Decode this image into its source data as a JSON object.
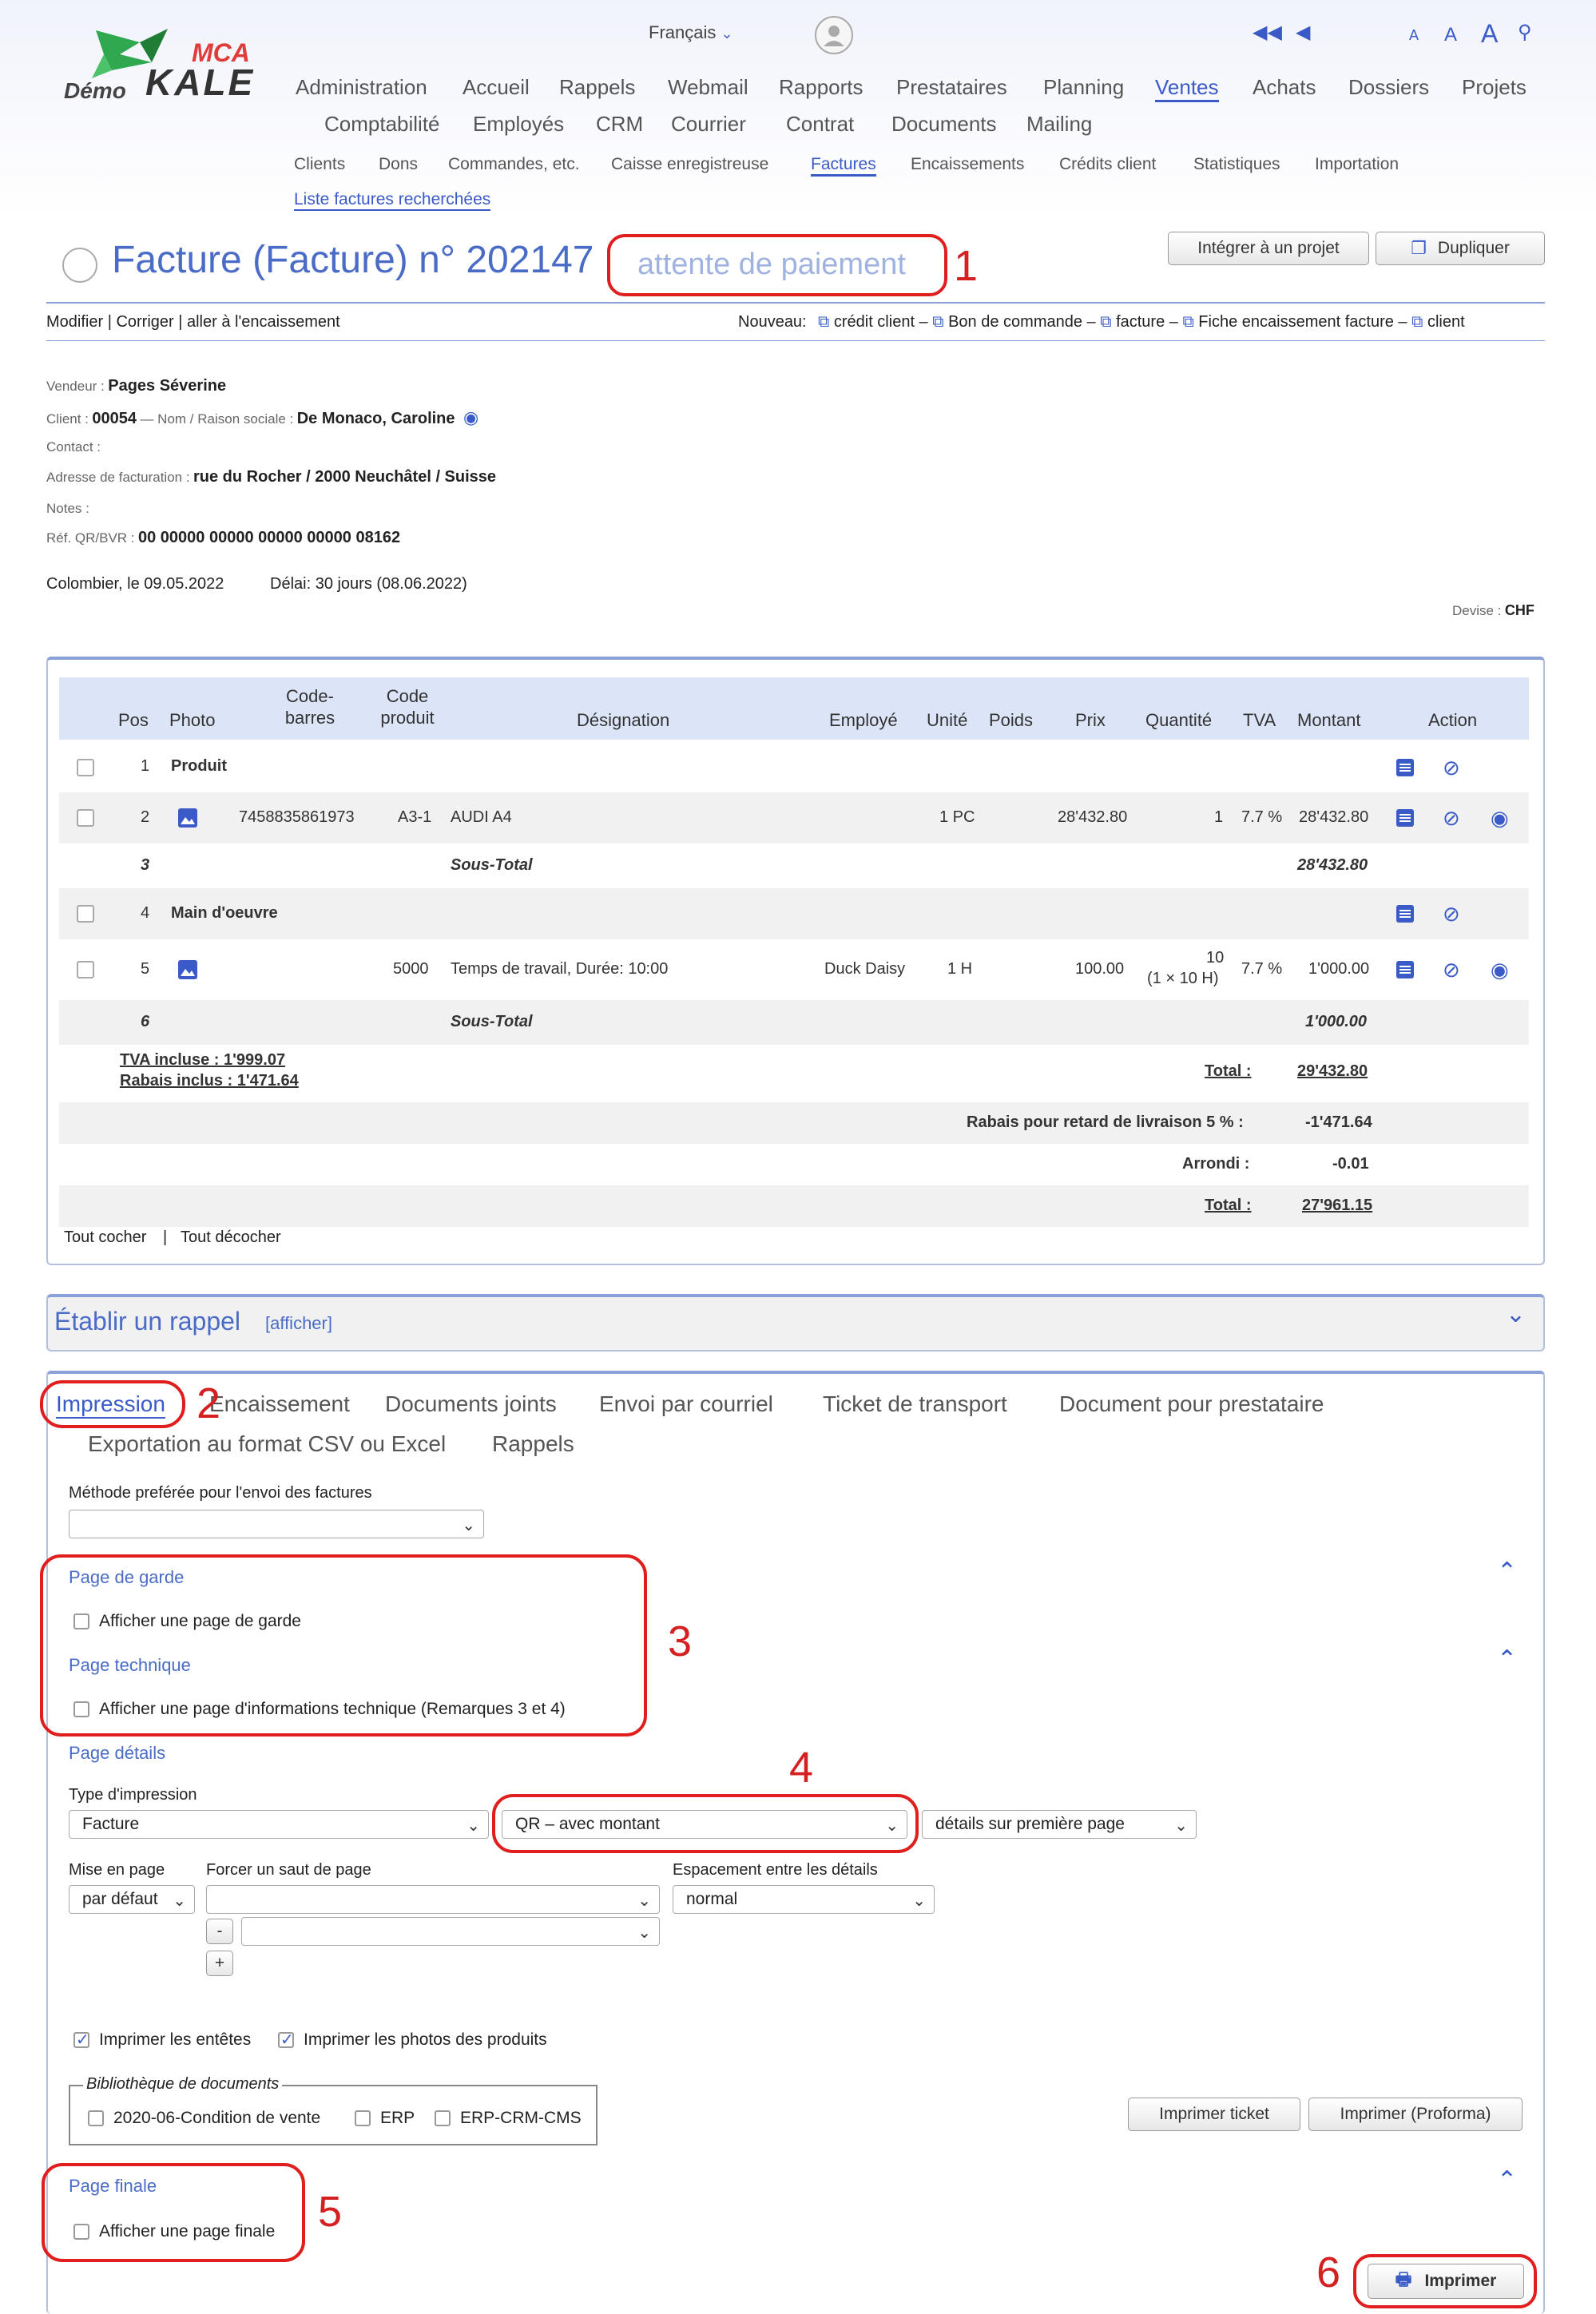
{
  "header": {
    "language": "Français",
    "logo": {
      "top": "MCA",
      "bottom": "KALE",
      "prefix": "Démo"
    },
    "nav_row1": [
      "Administration",
      "Accueil",
      "Rappels",
      "Webmail",
      "Rapports",
      "Prestataires",
      "Planning",
      "Ventes",
      "Achats",
      "Dossiers",
      "Projets"
    ],
    "nav_row2": [
      "Comptabilité",
      "Employés",
      "CRM",
      "Courrier",
      "Contrat",
      "Documents",
      "Mailing"
    ],
    "sub_row1": [
      "Clients",
      "Dons",
      "Commandes, etc.",
      "Caisse enregistreuse",
      "Factures",
      "Encaissements",
      "Crédits client",
      "Statistiques",
      "Importation"
    ],
    "sub_row2": "Liste factures recherchées",
    "text_size": [
      "A",
      "A",
      "A"
    ]
  },
  "invoice": {
    "title": "Facture (Facture) n° 202147",
    "status": "attente de paiement",
    "btn_integrate": "Intégrer à un projet",
    "btn_duplicate": "Dupliquer",
    "actions_left": "Modifier | Corriger | aller à l'encaissement",
    "new_label": "Nouveau:",
    "new_links": [
      "crédit client –",
      "Bon de commande –",
      "facture –",
      "Fiche encaissement facture –",
      "client"
    ],
    "seller_label": "Vendeur :",
    "seller": "Pages Séverine",
    "client_label": "Client :",
    "client_id": "00054",
    "client_sep": "— Nom / Raison sociale :",
    "client_name": "De Monaco, Caroline",
    "contact_label": "Contact :",
    "address_label": "Adresse de facturation :",
    "address": "rue du Rocher / 2000 Neuchâtel / Suisse",
    "notes_label": "Notes :",
    "ref_label": "Réf. QR/BVR :",
    "ref": "00 00000 00000 00000 00000 08162",
    "place_date": "Colombier, le 09.05.2022",
    "delay": "Délai: 30 jours (08.06.2022)",
    "currency_label": "Devise :",
    "currency": "CHF"
  },
  "table": {
    "headers": [
      "Pos",
      "Photo",
      "Code-\nbarres",
      "Code\nproduit",
      "Désignation",
      "Employé",
      "Unité",
      "Poids",
      "Prix",
      "Quantité",
      "TVA",
      "Montant",
      "Action"
    ],
    "rows": [
      {
        "pos": "1",
        "designation": "Produit"
      },
      {
        "pos": "2",
        "barcode": "7458835861973",
        "code": "A3-1",
        "designation": "AUDI A4",
        "unit": "1 PC",
        "price": "28'432.80",
        "qty": "1",
        "vat": "7.7 %",
        "amount": "28'432.80"
      },
      {
        "pos": "3",
        "designation": "Sous-Total",
        "amount": "28'432.80"
      },
      {
        "pos": "4",
        "designation": "Main d'oeuvre"
      },
      {
        "pos": "5",
        "code": "5000",
        "designation": "Temps de travail, Durée: 10:00",
        "employee": "Duck Daisy",
        "unit": "1 H",
        "price": "100.00",
        "qty": "10",
        "qty_detail": "(1 × 10 H)",
        "vat": "7.7 %",
        "amount": "1'000.00"
      },
      {
        "pos": "6",
        "designation": "Sous-Total",
        "amount": "1'000.00"
      }
    ],
    "vat_included": "TVA incluse : 1'999.07",
    "discount_included": "Rabais inclus : 1'471.64",
    "total_label": "Total :",
    "total": "29'432.80",
    "late_label": "Rabais pour retard de livraison 5 % :",
    "late_value": "-1'471.64",
    "round_label": "Arrondi :",
    "round_value": "-0.01",
    "final_label": "Total :",
    "final_value": "27'961.15",
    "check_all": "Tout cocher",
    "uncheck_all": "Tout décocher"
  },
  "reminder": {
    "title": "Établir un rappel",
    "show": "[afficher]"
  },
  "print": {
    "tabs_row1": [
      "Impression",
      "Encaissement",
      "Documents joints",
      "Envoi par courriel",
      "Ticket de transport",
      "Document pour prestataire"
    ],
    "tabs_row2": [
      "Exportation au format CSV ou Excel",
      "Rappels"
    ],
    "method_label": "Méthode preférée pour l'envoi des factures",
    "cover_title": "Page de garde",
    "cover_cb": "Afficher une page de garde",
    "tech_title": "Page technique",
    "tech_cb": "Afficher une page d'informations technique (Remarques 3 et 4)",
    "details_title": "Page détails",
    "type_label": "Type d'impression",
    "type_value": "Facture",
    "qr_value": "QR – avec montant",
    "detail_value": "détails sur première page",
    "layout_label": "Mise en page",
    "layout_value": "par défaut",
    "break_label": "Forcer un saut de page",
    "spacing_label": "Espacement entre les détails",
    "spacing_value": "normal",
    "minus": "-",
    "plus": "+",
    "cb_headers": "Imprimer les entêtes",
    "cb_photos": "Imprimer les photos des produits",
    "library_legend": "Bibliothèque de documents",
    "library_items": [
      "2020-06-Condition de vente",
      "ERP",
      "ERP-CRM-CMS"
    ],
    "btn_ticket": "Imprimer ticket",
    "btn_proforma": "Imprimer (Proforma)",
    "final_title": "Page finale",
    "final_cb": "Afficher une page finale",
    "btn_print": "Imprimer"
  },
  "annotations": [
    "1",
    "2",
    "3",
    "4",
    "5",
    "6"
  ]
}
